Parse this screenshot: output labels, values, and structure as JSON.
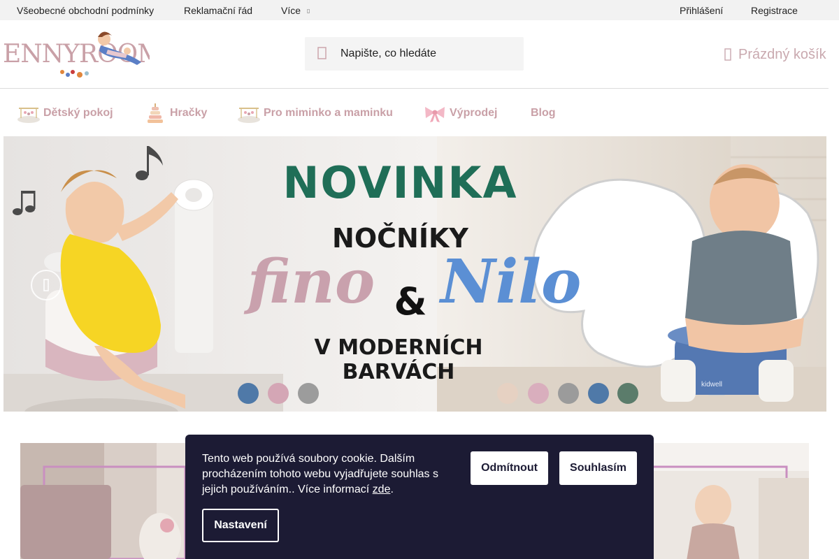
{
  "topbar": {
    "links": [
      "Všeobecné obchodní podmínky",
      "Reklamační řád",
      "Více"
    ],
    "login": "Přihlášení",
    "register": "Registrace"
  },
  "header": {
    "logo_text": "ENNYROOM",
    "search": {
      "placeholder": "Napište, co hledáte"
    },
    "cart": {
      "label": "Prázdný košík"
    }
  },
  "nav": {
    "items": [
      {
        "label": "Dětský pokoj",
        "icon": "crib-mobile-icon"
      },
      {
        "label": "Hračky",
        "icon": "stacking-toy-icon"
      },
      {
        "label": "Pro miminko a maminku",
        "icon": "crib-mobile-icon"
      },
      {
        "label": "Výprodej",
        "icon": "bow-icon"
      },
      {
        "label": "Blog",
        "icon": ""
      }
    ]
  },
  "banner": {
    "headline": "NOVINKA",
    "subline": "NOČNÍKY",
    "name_left": "fino",
    "ampersand": "&",
    "name_right": "Nilo",
    "footer_line1": "V MODERNÍCH",
    "footer_line2": "BARVÁCH",
    "brand": "kidwell",
    "colors": {
      "headline": "#1f6e57",
      "fino": "#c9a1ad",
      "nilo": "#5b8fd4",
      "dots_left": [
        "#4f79a8",
        "#d4a6b5",
        "#9c9c9c"
      ],
      "dots_right": [
        "#e6d1c2",
        "#d9aebd",
        "#9b9b9b",
        "#4f79a8",
        "#5b7c6b"
      ]
    }
  },
  "cookie": {
    "text": "Tento web používá soubory cookie. Dalším procházením tohoto webu vyjadřujete souhlas s jejich používáním.. Více informací",
    "link": "zde",
    "end": ".",
    "decline": "Odmítnout",
    "accept": "Souhlasím",
    "settings": "Nastavení"
  },
  "colors": {
    "brand_pink": "#c9a0a7",
    "cookie_bg": "#1c1b34",
    "topbar_bg": "#f2f2f2"
  }
}
